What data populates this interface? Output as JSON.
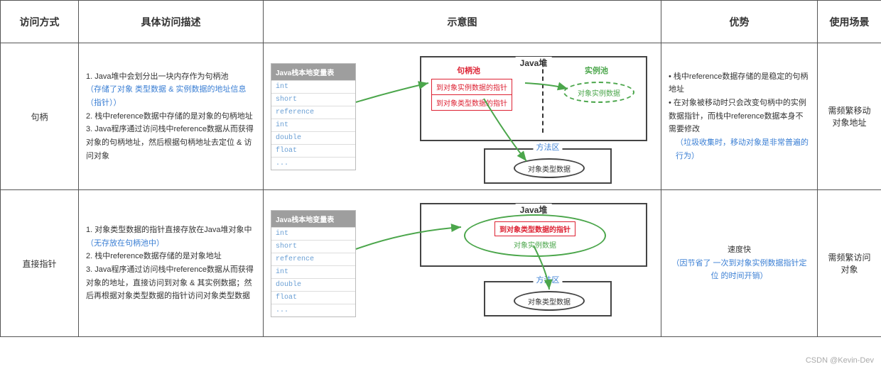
{
  "headers": {
    "col1": "访问方式",
    "col2": "具体访问描述",
    "col3": "示意图",
    "col4": "优势",
    "col5": "使用场景"
  },
  "rows": [
    {
      "method": "句柄",
      "desc": {
        "l1": "1. Java堆中会划分出一块内存作为句柄池",
        "l1b": "（存储了对象 类型数据 & 实例数据的地址信息（指针））",
        "l2": "2. 栈中reference数据中存储的是对象的句柄地址",
        "l3": "3. Java程序通过访问栈中reference数据从而获得对象的句柄地址，然后根据句柄地址去定位 & 访问对象"
      },
      "diagram": {
        "stack_title": "Java栈本地变量表",
        "stack_rows": [
          "int",
          "short",
          "reference",
          "int",
          "double",
          "float",
          "..."
        ],
        "heap_title": "Java堆",
        "handle_pool_label": "句柄池",
        "instance_pool_label": "实例池",
        "handle_ptr1": "到对象实例数据的指针",
        "handle_ptr2": "到对象类型数据的指针",
        "instance_text": "对象实例数据",
        "method_area": "方法区",
        "type_text": "对象类型数据"
      },
      "advantage": {
        "a1": "栈中reference数据存储的是稳定的句柄地址",
        "a2": "在对象被移动时只会改变句柄中的实例数据指针，而栈中reference数据本身不需要修改",
        "a2b": "（垃圾收集时，移动对象是非常普遍的行为）"
      },
      "scenario": "需频繁移动对象地址"
    },
    {
      "method": "直接指针",
      "desc": {
        "l1": "1. 对象类型数据的指针直接存放在Java堆对象中",
        "l1b": "（无存放在句柄池中）",
        "l2": "2. 栈中reference数据存储的是对象地址",
        "l3": "3. Java程序通过访问栈中reference数据从而获得对象的地址，直接访问到对象 & 其实例数据；然后再根据对象类型数据的指针访问对象类型数据"
      },
      "diagram": {
        "stack_title": "Java栈本地变量表",
        "stack_rows": [
          "int",
          "short",
          "reference",
          "int",
          "double",
          "float",
          "..."
        ],
        "heap_title": "Java堆",
        "type_ptr": "到对象类型数据的指针",
        "instance_text": "对象实例数据",
        "method_area": "方法区",
        "type_text": "对象类型数据"
      },
      "advantage": {
        "a1": "速度快",
        "a1b": "（因节省了 一次到对象实例数据指针定位 的时间开销）"
      },
      "scenario": "需频繁访问对象"
    }
  ],
  "watermark": "CSDN @Kevin-Dev"
}
